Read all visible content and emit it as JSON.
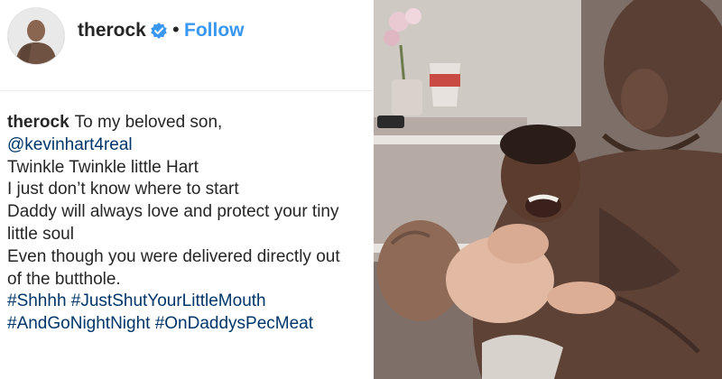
{
  "header": {
    "username": "therock",
    "separator": "•",
    "follow_label": "Follow",
    "verified_icon": "verified-badge-icon",
    "accent_color": "#3897f0"
  },
  "caption": {
    "author": "therock",
    "lines": [
      "To my beloved son,",
      "@kevinhart4real",
      "Twinkle Twinkle little Hart",
      "I just don’t know where to start",
      "Daddy will always love and protect your tiny",
      "little soul",
      "Even though you were delivered directly out",
      "of the butthole.",
      "#Shhhh #JustShutYourLittleMouth",
      "#AndGoNightNight #OnDaddysPecMeat"
    ],
    "link_color": "#003569"
  }
}
